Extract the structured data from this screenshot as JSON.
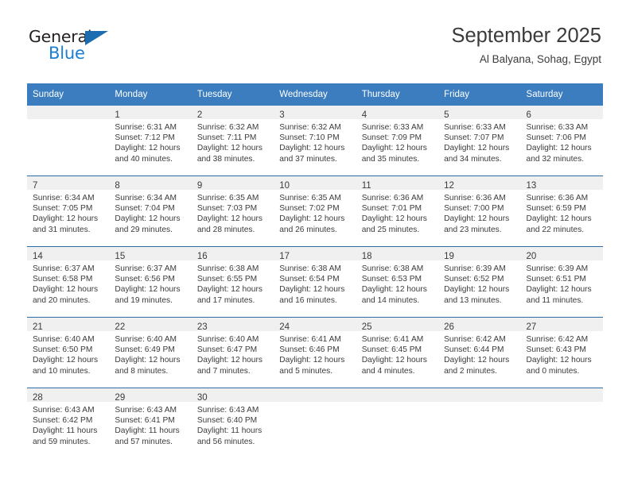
{
  "brand": {
    "name_top": "General",
    "name_bottom": "Blue",
    "accent_color": "#1b7fd4",
    "triangle_color": "#1b6cb0"
  },
  "header": {
    "title": "September 2025",
    "location": "Al Balyana, Sohag, Egypt"
  },
  "theme": {
    "header_bg": "#3b7dbe",
    "row_divider": "#2e6da4",
    "daynum_band": "#f0f0f0",
    "text": "#3b3b3b"
  },
  "weekdays": [
    "Sunday",
    "Monday",
    "Tuesday",
    "Wednesday",
    "Thursday",
    "Friday",
    "Saturday"
  ],
  "weeks": [
    [
      {
        "day": "",
        "sunrise": "",
        "sunset": "",
        "daylight1": "",
        "daylight2": ""
      },
      {
        "day": "1",
        "sunrise": "Sunrise: 6:31 AM",
        "sunset": "Sunset: 7:12 PM",
        "daylight1": "Daylight: 12 hours",
        "daylight2": "and 40 minutes."
      },
      {
        "day": "2",
        "sunrise": "Sunrise: 6:32 AM",
        "sunset": "Sunset: 7:11 PM",
        "daylight1": "Daylight: 12 hours",
        "daylight2": "and 38 minutes."
      },
      {
        "day": "3",
        "sunrise": "Sunrise: 6:32 AM",
        "sunset": "Sunset: 7:10 PM",
        "daylight1": "Daylight: 12 hours",
        "daylight2": "and 37 minutes."
      },
      {
        "day": "4",
        "sunrise": "Sunrise: 6:33 AM",
        "sunset": "Sunset: 7:09 PM",
        "daylight1": "Daylight: 12 hours",
        "daylight2": "and 35 minutes."
      },
      {
        "day": "5",
        "sunrise": "Sunrise: 6:33 AM",
        "sunset": "Sunset: 7:07 PM",
        "daylight1": "Daylight: 12 hours",
        "daylight2": "and 34 minutes."
      },
      {
        "day": "6",
        "sunrise": "Sunrise: 6:33 AM",
        "sunset": "Sunset: 7:06 PM",
        "daylight1": "Daylight: 12 hours",
        "daylight2": "and 32 minutes."
      }
    ],
    [
      {
        "day": "7",
        "sunrise": "Sunrise: 6:34 AM",
        "sunset": "Sunset: 7:05 PM",
        "daylight1": "Daylight: 12 hours",
        "daylight2": "and 31 minutes."
      },
      {
        "day": "8",
        "sunrise": "Sunrise: 6:34 AM",
        "sunset": "Sunset: 7:04 PM",
        "daylight1": "Daylight: 12 hours",
        "daylight2": "and 29 minutes."
      },
      {
        "day": "9",
        "sunrise": "Sunrise: 6:35 AM",
        "sunset": "Sunset: 7:03 PM",
        "daylight1": "Daylight: 12 hours",
        "daylight2": "and 28 minutes."
      },
      {
        "day": "10",
        "sunrise": "Sunrise: 6:35 AM",
        "sunset": "Sunset: 7:02 PM",
        "daylight1": "Daylight: 12 hours",
        "daylight2": "and 26 minutes."
      },
      {
        "day": "11",
        "sunrise": "Sunrise: 6:36 AM",
        "sunset": "Sunset: 7:01 PM",
        "daylight1": "Daylight: 12 hours",
        "daylight2": "and 25 minutes."
      },
      {
        "day": "12",
        "sunrise": "Sunrise: 6:36 AM",
        "sunset": "Sunset: 7:00 PM",
        "daylight1": "Daylight: 12 hours",
        "daylight2": "and 23 minutes."
      },
      {
        "day": "13",
        "sunrise": "Sunrise: 6:36 AM",
        "sunset": "Sunset: 6:59 PM",
        "daylight1": "Daylight: 12 hours",
        "daylight2": "and 22 minutes."
      }
    ],
    [
      {
        "day": "14",
        "sunrise": "Sunrise: 6:37 AM",
        "sunset": "Sunset: 6:58 PM",
        "daylight1": "Daylight: 12 hours",
        "daylight2": "and 20 minutes."
      },
      {
        "day": "15",
        "sunrise": "Sunrise: 6:37 AM",
        "sunset": "Sunset: 6:56 PM",
        "daylight1": "Daylight: 12 hours",
        "daylight2": "and 19 minutes."
      },
      {
        "day": "16",
        "sunrise": "Sunrise: 6:38 AM",
        "sunset": "Sunset: 6:55 PM",
        "daylight1": "Daylight: 12 hours",
        "daylight2": "and 17 minutes."
      },
      {
        "day": "17",
        "sunrise": "Sunrise: 6:38 AM",
        "sunset": "Sunset: 6:54 PM",
        "daylight1": "Daylight: 12 hours",
        "daylight2": "and 16 minutes."
      },
      {
        "day": "18",
        "sunrise": "Sunrise: 6:38 AM",
        "sunset": "Sunset: 6:53 PM",
        "daylight1": "Daylight: 12 hours",
        "daylight2": "and 14 minutes."
      },
      {
        "day": "19",
        "sunrise": "Sunrise: 6:39 AM",
        "sunset": "Sunset: 6:52 PM",
        "daylight1": "Daylight: 12 hours",
        "daylight2": "and 13 minutes."
      },
      {
        "day": "20",
        "sunrise": "Sunrise: 6:39 AM",
        "sunset": "Sunset: 6:51 PM",
        "daylight1": "Daylight: 12 hours",
        "daylight2": "and 11 minutes."
      }
    ],
    [
      {
        "day": "21",
        "sunrise": "Sunrise: 6:40 AM",
        "sunset": "Sunset: 6:50 PM",
        "daylight1": "Daylight: 12 hours",
        "daylight2": "and 10 minutes."
      },
      {
        "day": "22",
        "sunrise": "Sunrise: 6:40 AM",
        "sunset": "Sunset: 6:49 PM",
        "daylight1": "Daylight: 12 hours",
        "daylight2": "and 8 minutes."
      },
      {
        "day": "23",
        "sunrise": "Sunrise: 6:40 AM",
        "sunset": "Sunset: 6:47 PM",
        "daylight1": "Daylight: 12 hours",
        "daylight2": "and 7 minutes."
      },
      {
        "day": "24",
        "sunrise": "Sunrise: 6:41 AM",
        "sunset": "Sunset: 6:46 PM",
        "daylight1": "Daylight: 12 hours",
        "daylight2": "and 5 minutes."
      },
      {
        "day": "25",
        "sunrise": "Sunrise: 6:41 AM",
        "sunset": "Sunset: 6:45 PM",
        "daylight1": "Daylight: 12 hours",
        "daylight2": "and 4 minutes."
      },
      {
        "day": "26",
        "sunrise": "Sunrise: 6:42 AM",
        "sunset": "Sunset: 6:44 PM",
        "daylight1": "Daylight: 12 hours",
        "daylight2": "and 2 minutes."
      },
      {
        "day": "27",
        "sunrise": "Sunrise: 6:42 AM",
        "sunset": "Sunset: 6:43 PM",
        "daylight1": "Daylight: 12 hours",
        "daylight2": "and 0 minutes."
      }
    ],
    [
      {
        "day": "28",
        "sunrise": "Sunrise: 6:43 AM",
        "sunset": "Sunset: 6:42 PM",
        "daylight1": "Daylight: 11 hours",
        "daylight2": "and 59 minutes."
      },
      {
        "day": "29",
        "sunrise": "Sunrise: 6:43 AM",
        "sunset": "Sunset: 6:41 PM",
        "daylight1": "Daylight: 11 hours",
        "daylight2": "and 57 minutes."
      },
      {
        "day": "30",
        "sunrise": "Sunrise: 6:43 AM",
        "sunset": "Sunset: 6:40 PM",
        "daylight1": "Daylight: 11 hours",
        "daylight2": "and 56 minutes."
      },
      {
        "day": "",
        "sunrise": "",
        "sunset": "",
        "daylight1": "",
        "daylight2": ""
      },
      {
        "day": "",
        "sunrise": "",
        "sunset": "",
        "daylight1": "",
        "daylight2": ""
      },
      {
        "day": "",
        "sunrise": "",
        "sunset": "",
        "daylight1": "",
        "daylight2": ""
      },
      {
        "day": "",
        "sunrise": "",
        "sunset": "",
        "daylight1": "",
        "daylight2": ""
      }
    ]
  ]
}
